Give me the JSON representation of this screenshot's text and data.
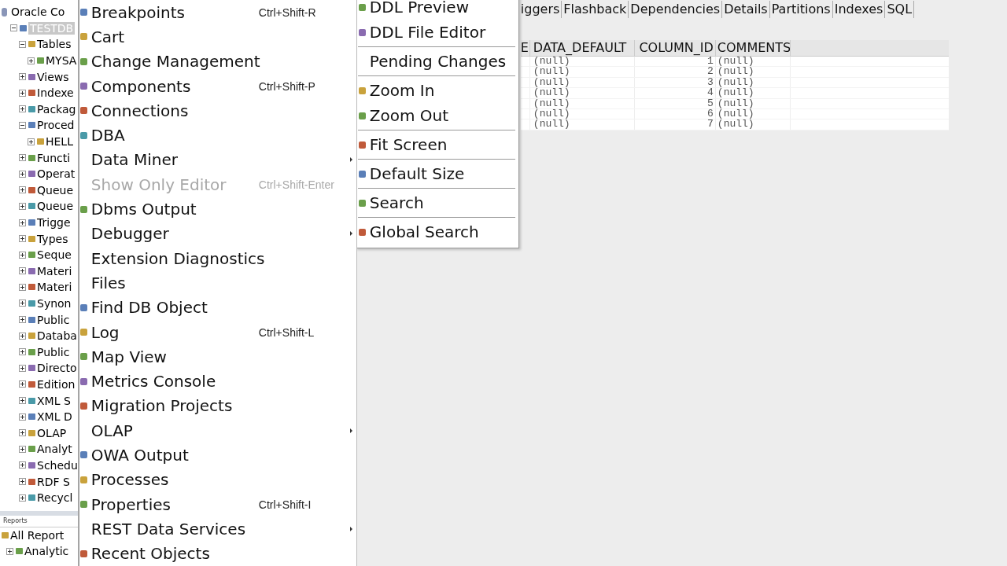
{
  "tree": [
    {
      "label": "Oracle Co",
      "children": [
        {
          "label": "TESTDB",
          "selected": true,
          "expanded": true,
          "children": [
            {
              "label": "Tables",
              "expanded": true,
              "children": [
                {
                  "label": "MYSA",
                  "expanded": false
                }
              ]
            },
            {
              "label": "Views",
              "expanded": false
            },
            {
              "label": "Indexe",
              "expanded": false
            },
            {
              "label": "Packag",
              "expanded": false
            },
            {
              "label": "Proced",
              "expanded": true,
              "children": [
                {
                  "label": "HELL",
                  "expanded": false
                }
              ]
            },
            {
              "label": "Functi",
              "expanded": false
            },
            {
              "label": "Operat",
              "expanded": false
            },
            {
              "label": "Queue",
              "expanded": false
            },
            {
              "label": "Queue",
              "expanded": false
            },
            {
              "label": "Trigge",
              "expanded": false
            },
            {
              "label": "Types",
              "expanded": false
            },
            {
              "label": "Seque",
              "expanded": false
            },
            {
              "label": "Materi",
              "expanded": false
            },
            {
              "label": "Materi",
              "expanded": false
            },
            {
              "label": "Synon",
              "expanded": false
            },
            {
              "label": "Public",
              "expanded": false
            },
            {
              "label": "Databa",
              "expanded": false
            },
            {
              "label": "Public",
              "expanded": false
            },
            {
              "label": "Directo",
              "expanded": false
            },
            {
              "label": "Edition",
              "expanded": false
            },
            {
              "label": "XML S",
              "expanded": false
            },
            {
              "label": "XML D",
              "expanded": false
            },
            {
              "label": "OLAP",
              "expanded": false
            },
            {
              "label": "Analyt",
              "expanded": false
            },
            {
              "label": "Schedu",
              "expanded": false
            },
            {
              "label": "RDF S",
              "expanded": false
            },
            {
              "label": "Recycl",
              "expanded": false
            }
          ]
        }
      ]
    }
  ],
  "reports": {
    "title": "Reports",
    "items": [
      {
        "label": "All Report"
      },
      {
        "label": "Analytic",
        "expanded": false
      }
    ]
  },
  "menu": [
    {
      "label": "Breakpoints",
      "icon": true,
      "shortcut": "Ctrl+Shift-R",
      "submenu": false,
      "disabled": false
    },
    {
      "label": "Cart",
      "icon": true,
      "submenu": false,
      "disabled": false
    },
    {
      "label": "Change Management",
      "icon": true,
      "submenu": false,
      "disabled": false
    },
    {
      "label": "Components",
      "icon": true,
      "shortcut": "Ctrl+Shift-P",
      "submenu": false,
      "disabled": false
    },
    {
      "label": "Connections",
      "icon": true,
      "submenu": false,
      "disabled": false
    },
    {
      "label": "DBA",
      "icon": true,
      "submenu": false,
      "disabled": false
    },
    {
      "label": "Data Miner",
      "icon": false,
      "submenu": true,
      "disabled": false
    },
    {
      "label": "Show Only Editor",
      "icon": false,
      "shortcut": "Ctrl+Shift-Enter",
      "submenu": false,
      "disabled": true
    },
    {
      "label": "Dbms Output",
      "icon": true,
      "submenu": false,
      "disabled": false
    },
    {
      "label": "Debugger",
      "icon": false,
      "submenu": true,
      "disabled": false
    },
    {
      "label": "Extension Diagnostics",
      "icon": false,
      "submenu": false,
      "disabled": false
    },
    {
      "label": "Files",
      "icon": false,
      "submenu": false,
      "disabled": false
    },
    {
      "label": "Find DB Object",
      "icon": true,
      "submenu": false,
      "disabled": false
    },
    {
      "label": "Log",
      "icon": true,
      "shortcut": "Ctrl+Shift-L",
      "submenu": false,
      "disabled": false
    },
    {
      "label": "Map View",
      "icon": true,
      "submenu": false,
      "disabled": false
    },
    {
      "label": "Metrics Console",
      "icon": true,
      "submenu": false,
      "disabled": false
    },
    {
      "label": "Migration Projects",
      "icon": true,
      "submenu": false,
      "disabled": false
    },
    {
      "label": "OLAP",
      "icon": false,
      "submenu": true,
      "disabled": false
    },
    {
      "label": "OWA Output",
      "icon": true,
      "submenu": false,
      "disabled": false
    },
    {
      "label": "Processes",
      "icon": true,
      "submenu": false,
      "disabled": false
    },
    {
      "label": "Properties",
      "icon": true,
      "shortcut": "Ctrl+Shift-I",
      "submenu": false,
      "disabled": false
    },
    {
      "label": "REST Data Services",
      "icon": false,
      "submenu": true,
      "disabled": false
    },
    {
      "label": "Recent Objects",
      "icon": true,
      "submenu": false,
      "disabled": false
    }
  ],
  "submenu": [
    {
      "kind": "item",
      "label": "DDL Preview",
      "icon": true
    },
    {
      "kind": "item",
      "label": "DDL File Editor",
      "icon": true
    },
    {
      "kind": "separator"
    },
    {
      "kind": "item",
      "label": "Pending Changes",
      "icon": false
    },
    {
      "kind": "separator"
    },
    {
      "kind": "item",
      "label": "Zoom In",
      "icon": true
    },
    {
      "kind": "item",
      "label": "Zoom Out",
      "icon": true
    },
    {
      "kind": "separator"
    },
    {
      "kind": "item",
      "label": "Fit Screen",
      "icon": true
    },
    {
      "kind": "separator"
    },
    {
      "kind": "item",
      "label": "Default Size",
      "icon": true
    },
    {
      "kind": "separator"
    },
    {
      "kind": "item",
      "label": "Search",
      "icon": true
    },
    {
      "kind": "separator"
    },
    {
      "kind": "item",
      "label": "Global Search",
      "icon": true
    }
  ],
  "tabs": [
    {
      "label": "iggers",
      "selected": false
    },
    {
      "label": "Flashback",
      "selected": false
    },
    {
      "label": "Dependencies",
      "selected": false
    },
    {
      "label": "Details",
      "selected": false
    },
    {
      "label": "Partitions",
      "selected": false
    },
    {
      "label": "Indexes",
      "selected": false
    },
    {
      "label": "SQL",
      "selected": false
    }
  ],
  "table": {
    "columns": [
      "E",
      "DATA_DEFAULT",
      "COLUMN_ID",
      "COMMENTS"
    ],
    "rows": [
      [
        "",
        "(null)",
        "1",
        "(null)"
      ],
      [
        "",
        "(null)",
        "2",
        "(null)"
      ],
      [
        "",
        "(null)",
        "3",
        "(null)"
      ],
      [
        "",
        "(null)",
        "4",
        "(null)"
      ],
      [
        "",
        "(null)",
        "5",
        "(null)"
      ],
      [
        "",
        "(null)",
        "6",
        "(null)"
      ],
      [
        "",
        "(null)",
        "7",
        "(null)"
      ]
    ]
  }
}
